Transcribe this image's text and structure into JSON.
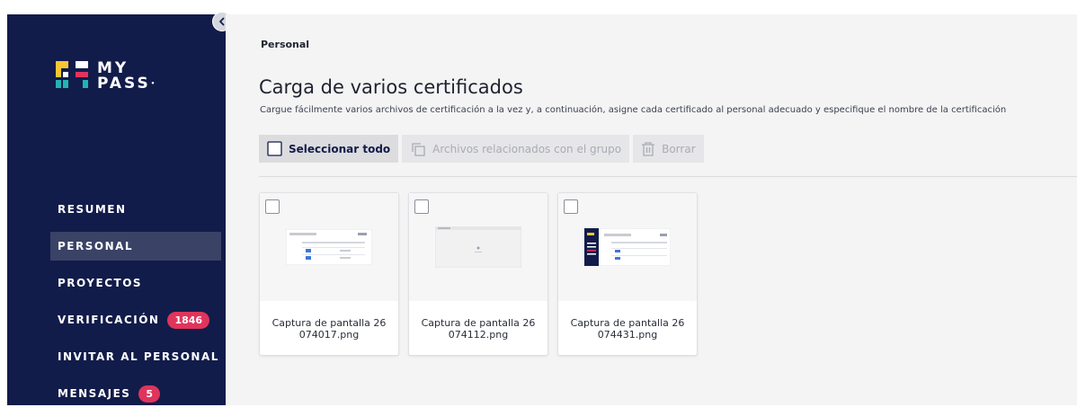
{
  "app": {
    "logo_text_line1": "MY",
    "logo_text_line2": "PASS",
    "logo_colors": {
      "yellow": "#f7c633",
      "teal": "#1fb5b0",
      "pink": "#e0345c",
      "white": "#ffffff"
    }
  },
  "sidebar": {
    "collapse_icon": "chevron-left-icon",
    "items": [
      {
        "label": "RESUMEN",
        "active": false
      },
      {
        "label": "PERSONAL",
        "active": true
      },
      {
        "label": "PROYECTOS",
        "active": false
      },
      {
        "label": "VERIFICACIÓN",
        "active": false,
        "badge": "1846"
      },
      {
        "label": "INVITAR AL PERSONAL",
        "active": false
      },
      {
        "label": "MENSAJES",
        "active": false,
        "badge": "5"
      }
    ]
  },
  "main": {
    "breadcrumb": "Personal",
    "title": "Carga de varios certificados",
    "subtitle": "Cargue fácilmente varios archivos de certificación a la vez y, a continuación, asigne cada certificado al personal adecuado y especifique el nombre de la certificación",
    "toolbar": {
      "select_all": "Seleccionar todo",
      "group_files": "Archivos relacionados con el grupo",
      "delete": "Borrar"
    },
    "files": [
      {
        "name_line1": "Captura de pantalla 26",
        "name_line2": "074017.png"
      },
      {
        "name_line1": "Captura de pantalla 26",
        "name_line2": "074112.png"
      },
      {
        "name_line1": "Captura de pantalla 26",
        "name_line2": "074431.png"
      }
    ]
  },
  "colors": {
    "sidebar_bg": "#121c4a",
    "badge": "#e0345c",
    "main_bg": "#f4f4f5"
  }
}
